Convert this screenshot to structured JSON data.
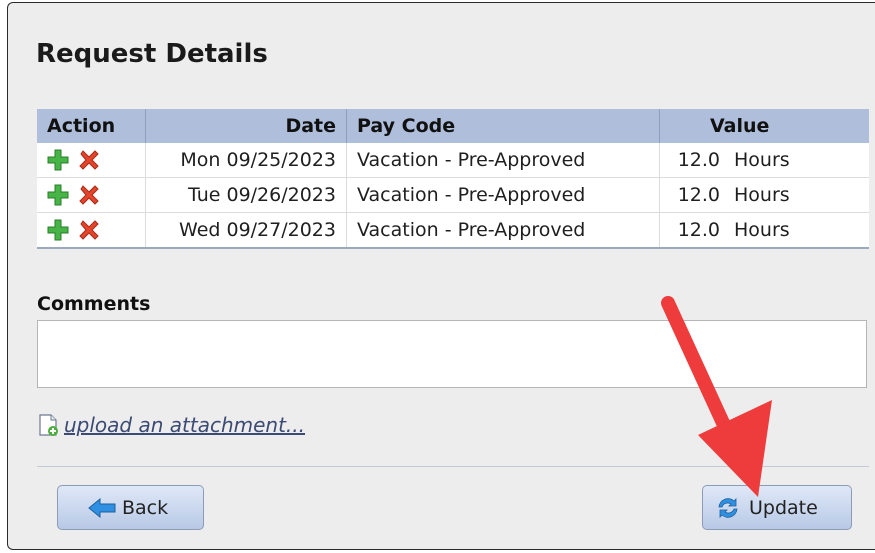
{
  "page": {
    "title": "Request Details"
  },
  "table": {
    "headers": [
      "Action",
      "Date",
      "Pay Code",
      "Value"
    ],
    "rows": [
      {
        "date": "Mon 09/25/2023",
        "pay_code": "Vacation - Pre-Approved",
        "value": "12.0",
        "unit": "Hours"
      },
      {
        "date": "Tue 09/26/2023",
        "pay_code": "Vacation - Pre-Approved",
        "value": "12.0",
        "unit": "Hours"
      },
      {
        "date": "Wed 09/27/2023",
        "pay_code": "Vacation - Pre-Approved",
        "value": "12.0",
        "unit": "Hours"
      }
    ]
  },
  "comments": {
    "label": "Comments",
    "value": ""
  },
  "upload": {
    "label": "upload an attachment..."
  },
  "buttons": {
    "back": "Back",
    "update": "Update"
  },
  "colors": {
    "header_bg": "#aebedb",
    "plus_icon": "#3aa53a",
    "delete_icon": "#e0402a",
    "annotation_arrow": "#ee3b3b"
  },
  "icons": [
    "plus-icon",
    "delete-x-icon",
    "attachment-icon",
    "back-arrow-icon",
    "refresh-icon"
  ]
}
